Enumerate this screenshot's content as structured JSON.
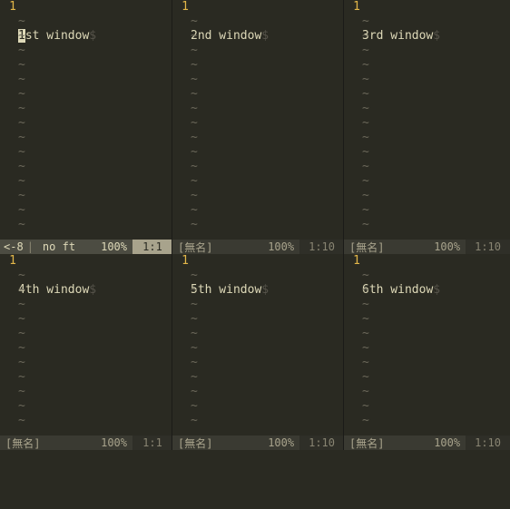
{
  "tildes_top": "~\n~\n~\n~\n~\n~\n~\n~\n~\n~\n~\n~\n~\n~\n~",
  "tildes_bot": "~\n~\n~\n~\n~\n~\n~\n~\n~\n~\n~",
  "eol_marker": "$",
  "panes": {
    "top": [
      {
        "line_num": "1",
        "pre_cursor": "",
        "cursor": "1",
        "post_cursor": "st window",
        "status": {
          "active": true,
          "prefix": "<-8",
          "sep": "|",
          "filetype": "no ft",
          "percent": "100%",
          "pos": "1:1"
        }
      },
      {
        "line_num": "1",
        "text": "2nd window",
        "status": {
          "active": false,
          "name": "[無名]",
          "percent": "100%",
          "pos": "1:10"
        }
      },
      {
        "line_num": "1",
        "text": "3rd window",
        "status": {
          "active": false,
          "name": "[無名]",
          "percent": "100%",
          "pos": "1:10"
        }
      }
    ],
    "bot": [
      {
        "line_num": "1",
        "text": "4th window",
        "status": {
          "active": false,
          "name": "[無名]",
          "percent": "100%",
          "pos": "1:1"
        }
      },
      {
        "line_num": "1",
        "text": "5th window",
        "status": {
          "active": false,
          "name": "[無名]",
          "percent": "100%",
          "pos": "1:10"
        }
      },
      {
        "line_num": "1",
        "text": "6th window",
        "status": {
          "active": false,
          "name": "[無名]",
          "percent": "100%",
          "pos": "1:10"
        }
      }
    ]
  }
}
